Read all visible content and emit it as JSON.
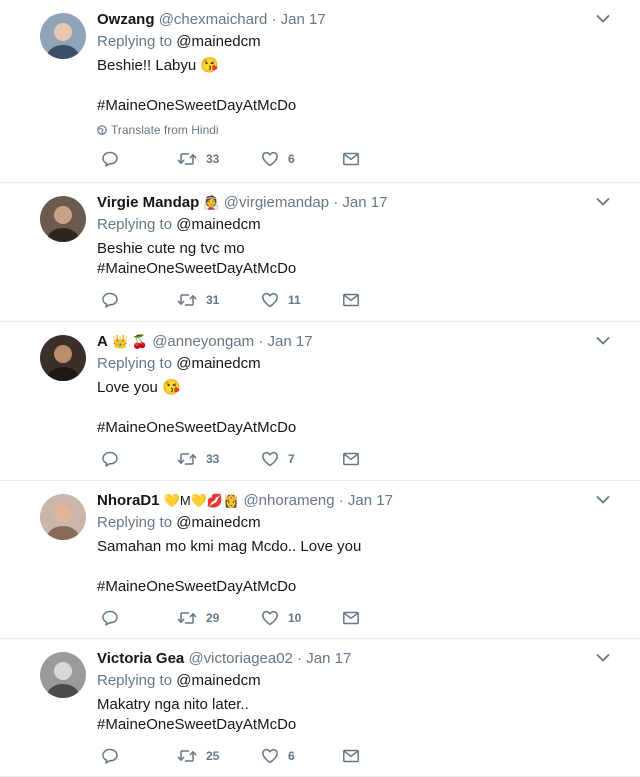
{
  "tweets": [
    {
      "name": "Owzang",
      "name_emoji": "",
      "handle": "@chexmaichard",
      "dot": "·",
      "time": "Jan 17",
      "replying_prefix": "Replying to",
      "replying_to": "@mainedcm",
      "text": "Beshie!! Labyu 😘\n\n#MaineOneSweetDayAtMcDo",
      "translate": "Translate from Hindi",
      "retweets": "33",
      "likes": "6"
    },
    {
      "name": "Virgie Mandap",
      "name_emoji": "👰",
      "handle": "@virgiemandap",
      "dot": "·",
      "time": "Jan 17",
      "replying_prefix": "Replying to",
      "replying_to": "@mainedcm",
      "text": "Beshie cute ng tvc mo\n#MaineOneSweetDayAtMcDo",
      "translate": "",
      "retweets": "31",
      "likes": "11"
    },
    {
      "name": "A",
      "name_emoji": "👑 🍒",
      "handle": "@anneyongam",
      "dot": "·",
      "time": "Jan 17",
      "replying_prefix": "Replying to",
      "replying_to": "@mainedcm",
      "text": "Love you 😘\n\n#MaineOneSweetDayAtMcDo",
      "translate": "",
      "retweets": "33",
      "likes": "7"
    },
    {
      "name": "NhoraD1",
      "name_emoji": "💛M💛💋👸",
      "handle": "@nhorameng",
      "dot": "·",
      "time": "Jan 17",
      "replying_prefix": "Replying to",
      "replying_to": "@mainedcm",
      "text": "Samahan mo kmi mag Mcdo.. Love you\n\n#MaineOneSweetDayAtMcDo",
      "translate": "",
      "retweets": "29",
      "likes": "10"
    },
    {
      "name": "Victoria Gea",
      "name_emoji": "",
      "handle": "@victoriagea02",
      "dot": "·",
      "time": "Jan 17",
      "replying_prefix": "Replying to",
      "replying_to": "@mainedcm",
      "text": "Makatry nga nito later..\n#MaineOneSweetDayAtMcDo",
      "translate": "",
      "retweets": "25",
      "likes": "6"
    }
  ],
  "icons": {
    "reply": "reply-icon",
    "retweet": "retweet-icon",
    "like": "heart-icon",
    "dm": "envelope-icon",
    "caret": "chevron-down-icon",
    "globe": "globe-icon"
  },
  "colors": {
    "text": "#14171a",
    "muted": "#657786",
    "divider": "#e6ecf0"
  }
}
